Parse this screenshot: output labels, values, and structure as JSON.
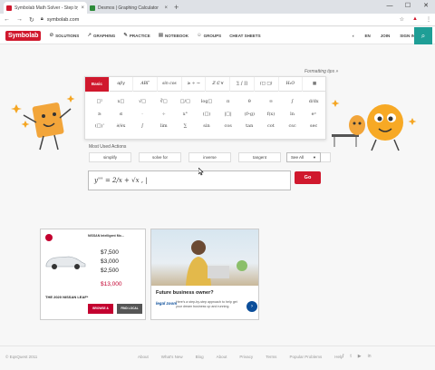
{
  "browser": {
    "tabs": [
      {
        "title": "Symbolab Math Solver - Step by S",
        "favicon_color": "#d0182d",
        "active": true
      },
      {
        "title": "Desmos | Graphing Calculator",
        "favicon_color": "#2e8b3a",
        "active": false
      }
    ],
    "new_tab": "+",
    "window_controls": [
      "—",
      "☐",
      "✕"
    ],
    "url": "symbolab.com",
    "nav": {
      "back": "←",
      "forward": "→",
      "reload": "↻"
    }
  },
  "header": {
    "logo": "Symbolab",
    "nav": [
      {
        "icon": "solutions-icon",
        "glyph": "⊘",
        "label": "SOLUTIONS"
      },
      {
        "icon": "graphing-icon",
        "glyph": "↗",
        "label": "GRAPHING"
      },
      {
        "icon": "practice-icon",
        "glyph": "✎",
        "label": "PRACTICE"
      },
      {
        "icon": "notebook-icon",
        "glyph": "▤",
        "label": "NOTEBOOK"
      },
      {
        "icon": "groups-icon",
        "glyph": "☺",
        "label": "GROUPS"
      },
      {
        "icon": "",
        "glyph": "",
        "label": "CHEAT SHEETS"
      }
    ],
    "lang": "EN",
    "join": "JOIN",
    "sign_in": "SIGN IN",
    "theme_glyph": "◐",
    "camera_glyph": "⌕"
  },
  "formatting_tips": "Formatting tips »",
  "keypad": {
    "tabs": [
      "Basic",
      "αβγ",
      "ABΓ",
      "sin cos",
      "≥ ÷ →",
      "ℤ ℂ ∀",
      "∑ ∫ ∏",
      "(□ □)",
      "H₂O",
      "▦"
    ],
    "active_tab": "Basic",
    "keys": [
      "□²",
      "x□",
      "√□",
      "∛□",
      "□/□",
      "log□",
      "π",
      "θ",
      "∞",
      "∫",
      "d/dx",
      "≥",
      "≤",
      "·",
      "÷",
      "x°",
      "(□)",
      "|□|",
      "(f∘g)",
      "f(x)",
      "ln",
      "eⁿ",
      "(□)'",
      "∂/∂x",
      "∫",
      "lim",
      "∑",
      "sin",
      "cos",
      "tan",
      "cot",
      "csc",
      "sec"
    ]
  },
  "actions": {
    "label": "Most Used Actions",
    "items": [
      "simplify",
      "solve for",
      "inverse",
      "tangent",
      "line"
    ],
    "see_all": "See All"
  },
  "input": {
    "value": "y''' = 2/x + √x , |"
  },
  "go": "Go",
  "ads": {
    "nissan": {
      "header": "NISSAN Intelligent Mo...",
      "prices": [
        "$7,500",
        "$3,000",
        "$2,500",
        "$13,000"
      ],
      "model": "THE 2020 NISSAN LEAF*",
      "btn1": "BROWSE & QUOTE",
      "btn2": "FIND LOCAL DEALERS"
    },
    "biz": {
      "headline": "Future business owner?",
      "brand": "legal zoom",
      "description": "Here's a step-by-step approach to help get your dream business up and running."
    }
  },
  "footer": {
    "copyright": "© EqsQuest 2011",
    "links": [
      "About",
      "What's New",
      "Blog",
      "About",
      "Privacy",
      "Terms",
      "Popular Problems",
      "Help"
    ],
    "social": [
      "f",
      "t",
      "▶",
      "in"
    ]
  },
  "colors": {
    "brand": "#d0182d",
    "teal": "#1e9e96"
  }
}
